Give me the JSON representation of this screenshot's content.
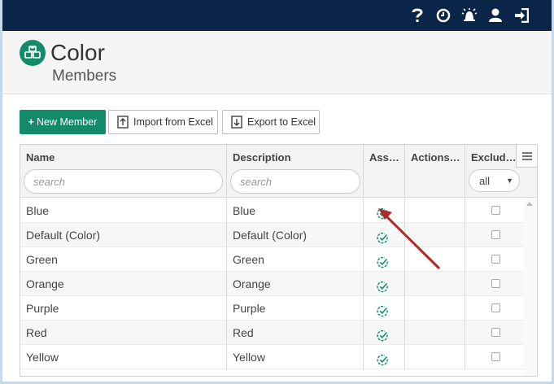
{
  "topbar": {
    "icons": [
      "help-icon",
      "clock-icon",
      "alarm-icon",
      "user-icon",
      "logout-icon"
    ]
  },
  "header": {
    "title": "Color",
    "subtitle": "Members",
    "logo_icon": "cubes-icon"
  },
  "toolbar": {
    "new_member_label": "New Member",
    "import_label": "Import from Excel",
    "export_label": "Export to Excel"
  },
  "grid": {
    "columns": [
      "Name",
      "Description",
      "Ass…",
      "Actions…",
      "Exclud…"
    ],
    "name_search_placeholder": "search",
    "description_search_placeholder": "search",
    "exclude_filter_value": "all",
    "rows": [
      {
        "name": "Blue",
        "description": "Blue",
        "assigned": true,
        "excluded": false
      },
      {
        "name": "Default (Color)",
        "description": "Default (Color)",
        "assigned": true,
        "excluded": false
      },
      {
        "name": "Green",
        "description": "Green",
        "assigned": true,
        "excluded": false
      },
      {
        "name": "Orange",
        "description": "Orange",
        "assigned": true,
        "excluded": false
      },
      {
        "name": "Purple",
        "description": "Purple",
        "assigned": true,
        "excluded": false
      },
      {
        "name": "Red",
        "description": "Red",
        "assigned": true,
        "excluded": false
      },
      {
        "name": "Yellow",
        "description": "Yellow",
        "assigned": true,
        "excluded": false
      }
    ]
  },
  "colors": {
    "topbar": "#0b2548",
    "accent": "#138a6a",
    "annotation_arrow": "#b02a2a"
  }
}
